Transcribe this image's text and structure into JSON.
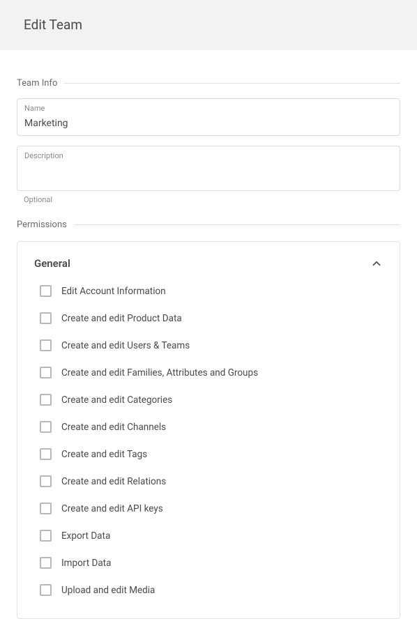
{
  "header": {
    "title": "Edit Team"
  },
  "sections": {
    "team_info_label": "Team Info",
    "permissions_label": "Permissions"
  },
  "fields": {
    "name": {
      "label": "Name",
      "value": "Marketing"
    },
    "description": {
      "label": "Description",
      "value": "",
      "helper": "Optional"
    }
  },
  "permissions_panel": {
    "title": "General",
    "expanded": true,
    "items": [
      {
        "label": "Edit Account Information",
        "checked": false
      },
      {
        "label": "Create and edit Product Data",
        "checked": false
      },
      {
        "label": "Create and edit Users & Teams",
        "checked": false
      },
      {
        "label": "Create and edit Families, Attributes and Groups",
        "checked": false
      },
      {
        "label": "Create and edit Categories",
        "checked": false
      },
      {
        "label": "Create and edit Channels",
        "checked": false
      },
      {
        "label": "Create and edit Tags",
        "checked": false
      },
      {
        "label": "Create and edit Relations",
        "checked": false
      },
      {
        "label": "Create and edit API keys",
        "checked": false
      },
      {
        "label": "Export Data",
        "checked": false
      },
      {
        "label": "Import Data",
        "checked": false
      },
      {
        "label": "Upload and edit Media",
        "checked": false
      }
    ]
  }
}
